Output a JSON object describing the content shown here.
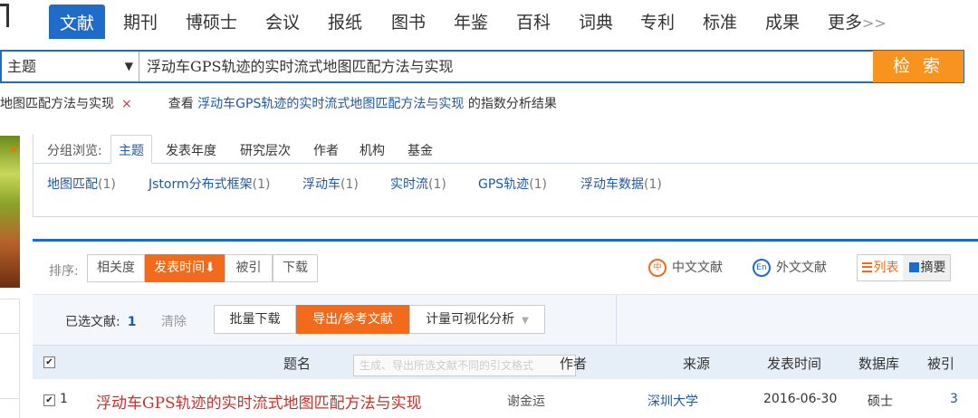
{
  "nav": {
    "tabs": [
      "文献",
      "期刊",
      "博硕士",
      "会议",
      "报纸",
      "图书",
      "年鉴",
      "百科",
      "词典",
      "专利",
      "标准",
      "成果",
      "更多"
    ],
    "more_arrows": ">>"
  },
  "search": {
    "field": "主题",
    "query": "浮动车GPS轨迹的实时流式地图匹配方法与实现",
    "button": "检 索"
  },
  "subline": {
    "crumb": "地图匹配方法与实现",
    "remove": "×",
    "prefix": "查看",
    "link": "浮动车GPS轨迹的实时流式地图匹配方法与实现",
    "suffix": "的指数分析结果"
  },
  "group": {
    "label": "分组浏览:",
    "tabs": [
      "主题",
      "发表年度",
      "研究层次",
      "作者",
      "机构",
      "基金"
    ],
    "items": [
      {
        "name": "地图匹配",
        "count": "(1)"
      },
      {
        "name": "Jstorm分布式框架",
        "count": "(1)"
      },
      {
        "name": "浮动车",
        "count": "(1)"
      },
      {
        "name": "实时流",
        "count": "(1)"
      },
      {
        "name": "GPS轨迹",
        "count": "(1)"
      },
      {
        "name": "浮动车数据",
        "count": "(1)"
      }
    ]
  },
  "sort": {
    "label": "排序:",
    "options": [
      "相关度",
      "发表时间",
      "被引",
      "下载"
    ],
    "active_arrow": "⬇"
  },
  "lang": {
    "cn_icon": "中",
    "cn": "中文文献",
    "en_icon": "En",
    "en": "外文文献"
  },
  "view": {
    "list": "列表",
    "abstract": "摘要"
  },
  "selection": {
    "label": "已选文献:",
    "count": "1",
    "clear": "清除",
    "batch_download": "批量下载",
    "export": "导出/参考文献",
    "visualize": "计量可视化分析",
    "dropdown": "▼"
  },
  "table": {
    "headers": [
      "题名",
      "作者",
      "来源",
      "发表时间",
      "数据库",
      "被引"
    ],
    "tooltip": "生成、导出所选文献不同的引文格式",
    "rows": [
      {
        "no": "1",
        "title": "浮动车GPS轨迹的实时流式地图匹配方法与实现",
        "author": "谢金运",
        "source": "深圳大学",
        "date": "2016-06-30",
        "db": "硕士",
        "cited": "3"
      }
    ]
  },
  "colors": {
    "primary": "#1e6cc7",
    "orange": "#f7931e",
    "sort_active": "#f26a1b",
    "link": "#1e58a6",
    "title_red": "#c8322c"
  }
}
